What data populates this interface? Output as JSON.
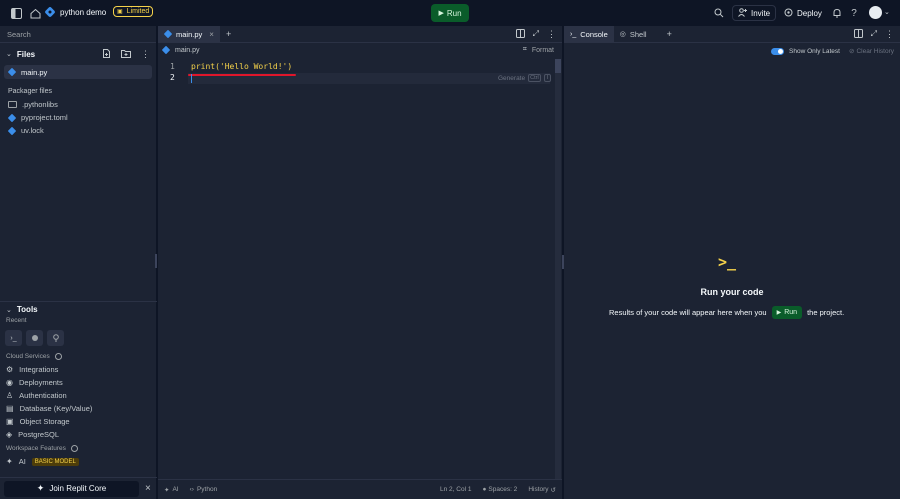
{
  "topbar": {
    "project_name": "python demo",
    "plan_badge": "Limited",
    "run_label": "Run",
    "invite_label": "Invite",
    "deploy_label": "Deploy",
    "help_label": "?"
  },
  "sidebar": {
    "search_placeholder": "Search",
    "files_header": "Files",
    "active_file": "main.py",
    "packager_header": "Packager files",
    "packager_items": [
      ".pythonlibs",
      "pyproject.toml",
      "uv.lock"
    ],
    "tools_header": "Tools",
    "recent_label": "Recent",
    "cloud_services_label": "Cloud Services",
    "cloud_items": [
      "Integrations",
      "Deployments",
      "Authentication",
      "Database (Key/Value)",
      "Object Storage",
      "PostgreSQL"
    ],
    "workspace_features_label": "Workspace Features",
    "ai_label": "AI",
    "ai_badge": "BASIC MODEL",
    "join_label": "Join Replit Core",
    "close_label": "×"
  },
  "editor": {
    "tab_label": "main.py",
    "tab_close": "×",
    "tab_add": "+",
    "breadcrumb": "main.py",
    "format_label": "Format",
    "line_numbers": [
      "1",
      "2"
    ],
    "code_line_1": "print('Hello World!')",
    "generate_label": "Generate",
    "generate_shortcut": "Ctrl",
    "generate_key": "I",
    "status_ai": "AI",
    "status_lang": "Python",
    "status_position": "Ln 2, Col 1",
    "status_spaces": "Spaces: 2",
    "status_history": "History"
  },
  "console": {
    "tab_console": "Console",
    "tab_shell": "Shell",
    "tab_add": "+",
    "show_only_latest": "Show Only Latest",
    "clear_history": "Clear History",
    "prompt_glyph": ">_",
    "heading": "Run your code",
    "desc_before": "Results of your code will appear here when you",
    "inline_run": "Run",
    "desc_after": "the project."
  },
  "colors": {
    "bg": "#0e1525",
    "panel": "#1c2333",
    "run_green": "#0a5c2a",
    "arrow_red": "#e0162b",
    "badge_yellow": "#f5d24a"
  }
}
